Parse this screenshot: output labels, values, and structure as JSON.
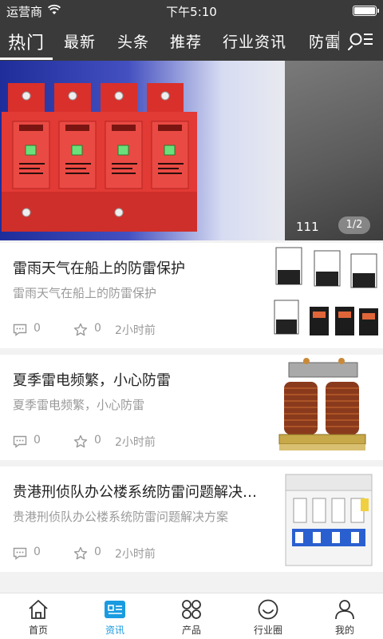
{
  "status_bar": {
    "carrier": "运营商",
    "time": "下午5:10"
  },
  "tabs": [
    {
      "label": "热门",
      "active": true
    },
    {
      "label": "最新"
    },
    {
      "label": "头条"
    },
    {
      "label": "推荐"
    },
    {
      "label": "行业资讯"
    },
    {
      "label": "防雷"
    }
  ],
  "banner": {
    "caption": "111",
    "pager": "1/2",
    "device_label": "SPD",
    "device_brand": "ruian",
    "device_model": "NPS01-FS"
  },
  "news": [
    {
      "title": "雷雨天气在船上的防雷保护",
      "summary": "雷雨天气在船上的防雷保护",
      "comments": "0",
      "favorites": "0",
      "time": "2小时前",
      "thumb_icon": "contactor-icon"
    },
    {
      "title": "夏季雷电频繁，小心防雷",
      "summary": "夏季雷电频繁，小心防雷",
      "comments": "0",
      "favorites": "0",
      "time": "2小时前",
      "thumb_icon": "transformer-icon"
    },
    {
      "title": "贵港刑侦队办公楼系统防雷问题解决方案",
      "summary": "贵港刑侦队办公楼系统防雷问题解决方案",
      "comments": "0",
      "favorites": "0",
      "time": "2小时前",
      "thumb_icon": "circuit-breaker-icon"
    }
  ],
  "bottom_nav": [
    {
      "label": "首页",
      "icon": "home-icon"
    },
    {
      "label": "资讯",
      "icon": "news-icon",
      "active": true
    },
    {
      "label": "产品",
      "icon": "grid-icon"
    },
    {
      "label": "行业圈",
      "icon": "smile-icon"
    },
    {
      "label": "我的",
      "icon": "user-icon"
    }
  ],
  "colors": {
    "header_bg": "#3a3a3a",
    "accent": "#1a9be0",
    "device_red": "#e23a35"
  }
}
